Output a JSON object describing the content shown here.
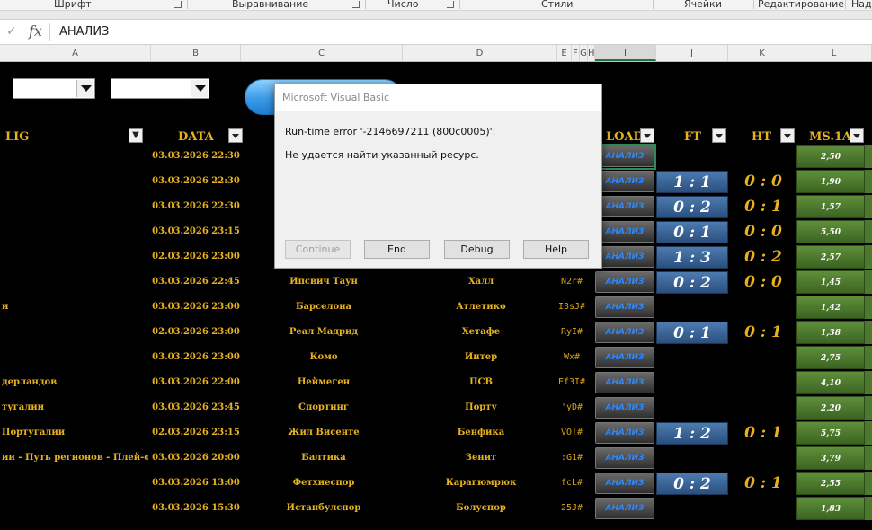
{
  "ribbon": {
    "groups": [
      "Шрифт",
      "Выравнивание",
      "Число",
      "Стили",
      "Ячейки",
      "Редактирование",
      "Над"
    ]
  },
  "formula_bar": {
    "confirm_icon": "check-icon",
    "fx_label": "fx",
    "value": "АНАЛИЗ"
  },
  "columns": [
    "A",
    "B",
    "C",
    "D",
    "E",
    "F",
    "G",
    "H",
    "I",
    "J",
    "K",
    "L"
  ],
  "selected_column": "I",
  "sheet": {
    "headers": {
      "lig": "LIG",
      "data": "DATA",
      "load": "LOAD",
      "ft": "FT",
      "ht": "HT",
      "ms1": "MS.1A"
    },
    "rows": [
      {
        "lig": "",
        "date": "03.03.2026 22:30",
        "home": "",
        "away": "",
        "code": "",
        "btn": "АНАЛИЗ",
        "ft": "",
        "ht": "",
        "ms": "2,50"
      },
      {
        "lig": "",
        "date": "03.03.2026 22:30",
        "home": "",
        "away": "",
        "code": "",
        "btn": "АНАЛИЗ",
        "ft": "1 : 1",
        "ht": "0 : 0",
        "ms": "1,90"
      },
      {
        "lig": "",
        "date": "03.03.2026 22:30",
        "home": "",
        "away": "",
        "code": "",
        "btn": "АНАЛИЗ",
        "ft": "0 : 2",
        "ht": "0 : 1",
        "ms": "1,57"
      },
      {
        "lig": "",
        "date": "03.03.2026 23:15",
        "home": "",
        "away": "",
        "code": "",
        "btn": "АНАЛИЗ",
        "ft": "0 : 1",
        "ht": "0 : 0",
        "ms": "5,50"
      },
      {
        "lig": "",
        "date": "02.03.2026 23:00",
        "home": "",
        "away": "",
        "code": "",
        "btn": "АНАЛИЗ",
        "ft": "1 : 3",
        "ht": "0 : 2",
        "ms": "2,57"
      },
      {
        "lig": "",
        "date": "03.03.2026 22:45",
        "home": "Ипсвич Таун",
        "away": "Халл",
        "code": "N2r#",
        "btn": "АНАЛИЗ",
        "ft": "0 : 2",
        "ht": "0 : 0",
        "ms": "1,45"
      },
      {
        "lig": "и",
        "date": "03.03.2026 23:00",
        "home": "Барселона",
        "away": "Атлетико",
        "code": "I3sJ#",
        "btn": "АНАЛИЗ",
        "ft": "",
        "ht": "",
        "ms": "1,42"
      },
      {
        "lig": "",
        "date": "02.03.2026 23:00",
        "home": "Реал Мадрид",
        "away": "Хетафе",
        "code": "RyI#",
        "btn": "АНАЛИЗ",
        "ft": "0 : 1",
        "ht": "0 : 1",
        "ms": "1,38"
      },
      {
        "lig": "",
        "date": "03.03.2026 23:00",
        "home": "Комо",
        "away": "Интер",
        "code": "Wx#",
        "btn": "АНАЛИЗ",
        "ft": "",
        "ht": "",
        "ms": "2,75"
      },
      {
        "lig": "дерландов",
        "date": "03.03.2026 22:00",
        "home": "Неймеген",
        "away": "ПСВ",
        "code": "Ef3I#",
        "btn": "АНАЛИЗ",
        "ft": "",
        "ht": "",
        "ms": "4,10"
      },
      {
        "lig": "тугалии",
        "date": "03.03.2026 23:45",
        "home": "Спортинг",
        "away": "Порту",
        "code": "'yD#",
        "btn": "АНАЛИЗ",
        "ft": "",
        "ht": "",
        "ms": "2,20"
      },
      {
        "lig": " Португалии",
        "date": "02.03.2026 23:15",
        "home": "Жил Висенте",
        "away": "Бенфика",
        "code": "VO!#",
        "btn": "АНАЛИЗ",
        "ft": "1 : 2",
        "ht": "0 : 1",
        "ms": "5,75"
      },
      {
        "lig": "ии - Путь регионов - Плей-офф",
        "date": "03.03.2026 20:00",
        "home": "Балтика",
        "away": "Зенит",
        "code": ":G1#",
        "btn": "АНАЛИЗ",
        "ft": "",
        "ht": "",
        "ms": "3,79"
      },
      {
        "lig": "",
        "date": "03.03.2026 13:00",
        "home": "Фетхиеспор",
        "away": "Карагюмрюк",
        "code": "fcL#",
        "btn": "АНАЛИЗ",
        "ft": "0 : 2",
        "ht": "0 : 1",
        "ms": "2,55"
      },
      {
        "lig": "",
        "date": "03.03.2026 15:30",
        "home": "Истанбулспор",
        "away": "Болуспор",
        "code": "25J#",
        "btn": "АНАЛИЗ",
        "ft": "",
        "ht": "",
        "ms": "1,83"
      }
    ]
  },
  "dialog": {
    "title": "Microsoft Visual Basic",
    "message_line1": "Run-time error '-2146697211 (800c0005)':",
    "message_line2": "Не удается найти указанный ресурс.",
    "buttons": {
      "continue": "Continue",
      "end": "End",
      "debug": "Debug",
      "help": "Help"
    }
  },
  "colors": {
    "gold_text": "#e8b21f",
    "ft_cell": "#3a6596",
    "ms_cell": "#4f7a2f",
    "analysis_text": "#2d88ff"
  }
}
